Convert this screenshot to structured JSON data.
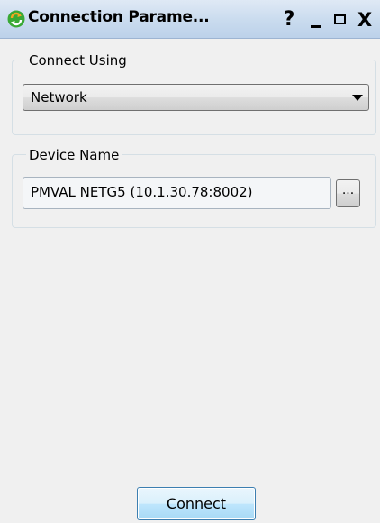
{
  "window": {
    "title": "Connection Parame...",
    "help_label": "?",
    "close_label": "X"
  },
  "connect_using": {
    "label": "Connect Using",
    "selected": "Network"
  },
  "device_name": {
    "label": "Device Name",
    "value": "PMVAL NETG5 (10.1.30.78:8002)",
    "browse_label": "..."
  },
  "actions": {
    "connect_label": "Connect"
  },
  "colors": {
    "titlebar": "#c9dbee",
    "app_icon_green": "#39a935",
    "app_icon_orange": "#f5a623",
    "connect_button_border": "#3c7fb1"
  }
}
